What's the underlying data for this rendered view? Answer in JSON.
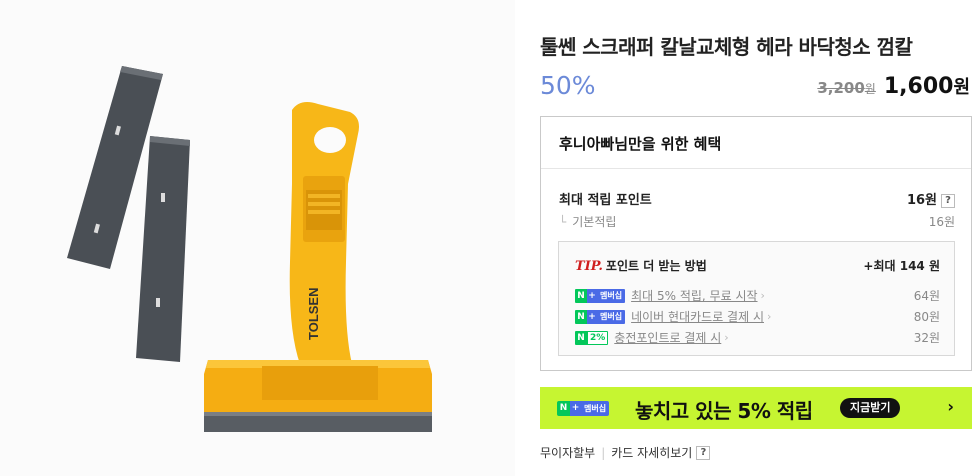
{
  "product": {
    "image_alt": "Tolsen scraper with replacement blades",
    "brand_on_image": "TOLSEN",
    "title": "툴쎈 스크래퍼 칼날교체형 헤라 바닥청소 껌칼",
    "discount": "50%",
    "original_price": "3,200",
    "original_unit": "원",
    "sale_price": "1,600",
    "sale_unit": "원"
  },
  "benefits": {
    "header": "후니아빠님만을 위한 혜택",
    "max_points_label": "최대 적립 포인트",
    "max_points_value": "16원",
    "help_mark": "?",
    "basic_tree": "└",
    "basic_label": "기본적립",
    "basic_value": "16원",
    "tip": {
      "tip_word": "TIP.",
      "title": "포인트 더 받는 방법",
      "max_extra": "+최대 144 원",
      "rows": [
        {
          "badge_n": "N",
          "badge_plus": "+",
          "badge_text": "멤버십",
          "label": "최대 5% 적립, 무료 시작",
          "chevron": "›",
          "value": "64원"
        },
        {
          "badge_n": "N",
          "badge_plus": "+",
          "badge_text": "멤버십",
          "label": "네이버 현대카드로 결제 시",
          "chevron": "›",
          "value": "80원"
        },
        {
          "badge_n": "N",
          "badge_text": "2%",
          "label": "충전포인트로 결제 시",
          "chevron": "›",
          "value": "32원"
        }
      ]
    }
  },
  "banner": {
    "badge_n": "N",
    "badge_plus": "+",
    "badge_text": "멤버십",
    "text": "놓치고 있는 5% 적립",
    "button": "지금받기",
    "arrow": "›"
  },
  "card": {
    "installment": "무이자할부",
    "separator": "|",
    "card_detail": "카드 자세히보기",
    "help_mark": "?"
  },
  "colors": {
    "discount": "#6c8ad8",
    "banner_bg": "#c6f531",
    "naver_green": "#03c75a",
    "membership_blue": "#4a6ae6",
    "tip_red": "#d01e1e",
    "scraper_yellow": "#f7b718"
  }
}
